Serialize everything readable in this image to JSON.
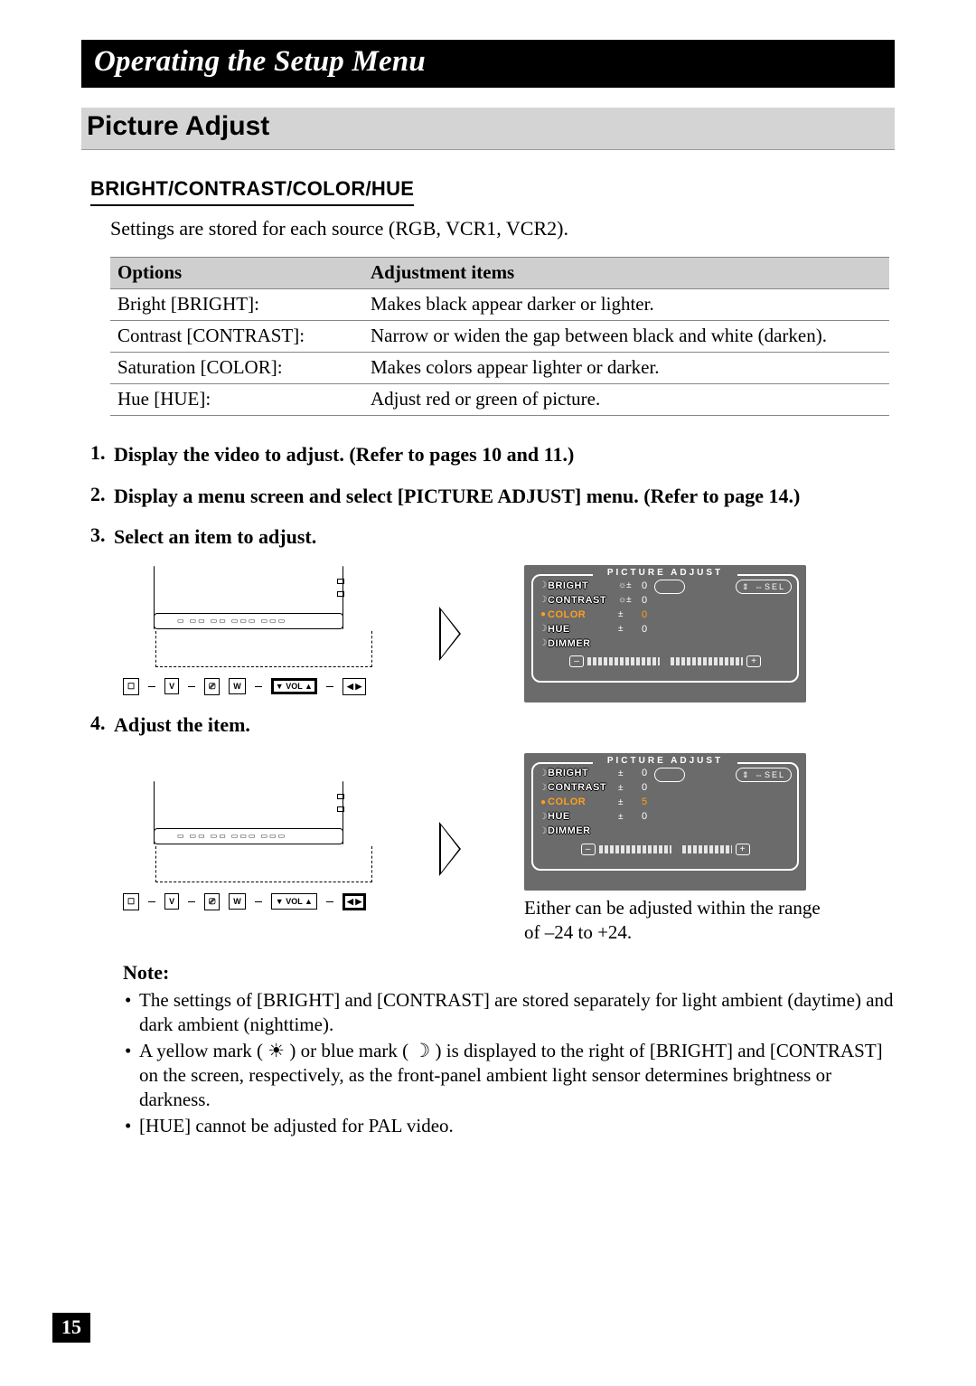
{
  "banner": {
    "title": "Operating the Setup Menu"
  },
  "section": {
    "heading": "Picture Adjust"
  },
  "subsection": {
    "heading": "BRIGHT/CONTRAST/COLOR/HUE",
    "intro": "Settings are stored for each source (RGB, VCR1, VCR2)."
  },
  "options_table": {
    "headers": {
      "options": "Options",
      "adjustment": "Adjustment items"
    },
    "rows": [
      {
        "option": "Bright [BRIGHT]:",
        "desc": "Makes black appear darker or lighter."
      },
      {
        "option": "Contrast [CONTRAST]:",
        "desc": "Narrow or widen the gap between black and white (darken)."
      },
      {
        "option": "Saturation [COLOR]:",
        "desc": "Makes colors appear lighter or darker."
      },
      {
        "option": "Hue [HUE]:",
        "desc": "Adjust red or green of picture."
      }
    ]
  },
  "procedure": [
    {
      "num": "1.",
      "text": "Display the video to adjust. (Refer to pages 10 and 11.)"
    },
    {
      "num": "2.",
      "text": "Display a menu screen and select [PICTURE ADJUST] menu. (Refer to page 14.)"
    },
    {
      "num": "3.",
      "text": "Select an item to adjust."
    },
    {
      "num": "4.",
      "text": "Adjust the item."
    }
  ],
  "keyboard": {
    "keys": [
      "☐",
      "V",
      "⎚",
      "W",
      "▼ VOL ▲",
      "◀   ▶"
    ]
  },
  "osd": {
    "title": "PICTURE ADJUST",
    "sel_label": "SEL",
    "rows": [
      {
        "label": "BRIGHT",
        "sym": "☼±",
        "val": "0"
      },
      {
        "label": "CONTRAST",
        "sym": "☼±",
        "val": "0"
      },
      {
        "label": "COLOR",
        "sym": "±",
        "val": "0",
        "selected": true
      },
      {
        "label": "HUE",
        "sym": "±",
        "val": "0"
      },
      {
        "label": "DIMMER",
        "sym": "",
        "val": ""
      }
    ],
    "minus": "–",
    "plus": "+"
  },
  "osd2": {
    "title": "PICTURE ADJUST",
    "sel_label": "SEL",
    "rows": [
      {
        "label": "BRIGHT",
        "sym": "±",
        "val": "0"
      },
      {
        "label": "CONTRAST",
        "sym": "±",
        "val": "0"
      },
      {
        "label": "COLOR",
        "sym": "±",
        "val": "5",
        "selected": true
      },
      {
        "label": "HUE",
        "sym": "±",
        "val": "0"
      },
      {
        "label": "DIMMER",
        "sym": "",
        "val": ""
      }
    ],
    "minus": "–",
    "plus": "+"
  },
  "osd_caption": "Either can be adjusted within the range of –24 to +24.",
  "notes": {
    "head": "Note:",
    "items": [
      "The settings of [BRIGHT] and [CONTRAST] are stored separately for light ambient (daytime) and dark ambient (nighttime).",
      "A yellow mark (  ☀  ) or blue mark (  ☽  ) is displayed to the right of [BRIGHT] and [CONTRAST] on the screen, respectively, as the front-panel ambient light sensor determines brightness or darkness.",
      "[HUE] cannot be adjusted for PAL video."
    ]
  },
  "page_number": "15"
}
